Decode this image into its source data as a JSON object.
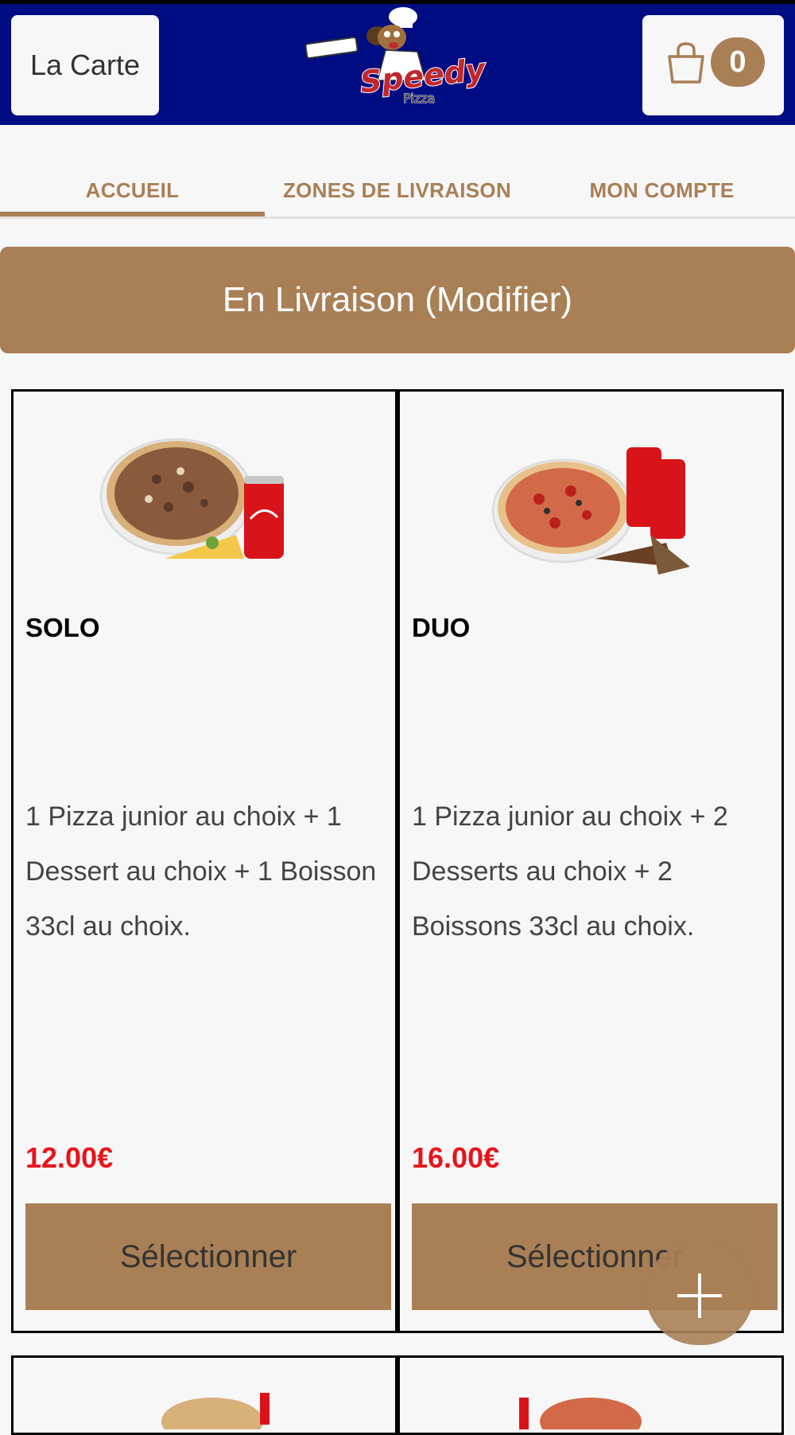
{
  "header": {
    "menu_label": "La Carte",
    "cart_count": "0",
    "logo_text": "Speedy",
    "logo_subtext": "Pizza",
    "bg_color": "#000c82"
  },
  "tabs": [
    {
      "label": "ACCUEIL",
      "active": true
    },
    {
      "label": "ZONES DE LIVRAISON",
      "active": false
    },
    {
      "label": "MON COMPTE",
      "active": false
    }
  ],
  "mode_banner": "En Livraison (Modifier)",
  "products": [
    {
      "title": "SOLO",
      "description": "1 Pizza junior au choix  + 1 Dessert au choix  + 1 Boisson 33cl au choix.",
      "price": "12.00€",
      "button_label": "Sélectionner"
    },
    {
      "title": "DUO",
      "description": "1 Pizza junior au choix  + 2 Desserts au choix  + 2 Boissons 33cl au choix.",
      "price": "16.00€",
      "button_label": "Sélectionner"
    }
  ],
  "colors": {
    "accent": "#a97f55",
    "price": "#e8141b",
    "header": "#000c82"
  },
  "icons": {
    "cart": "shopping-bag-icon",
    "fab": "plus-icon"
  }
}
